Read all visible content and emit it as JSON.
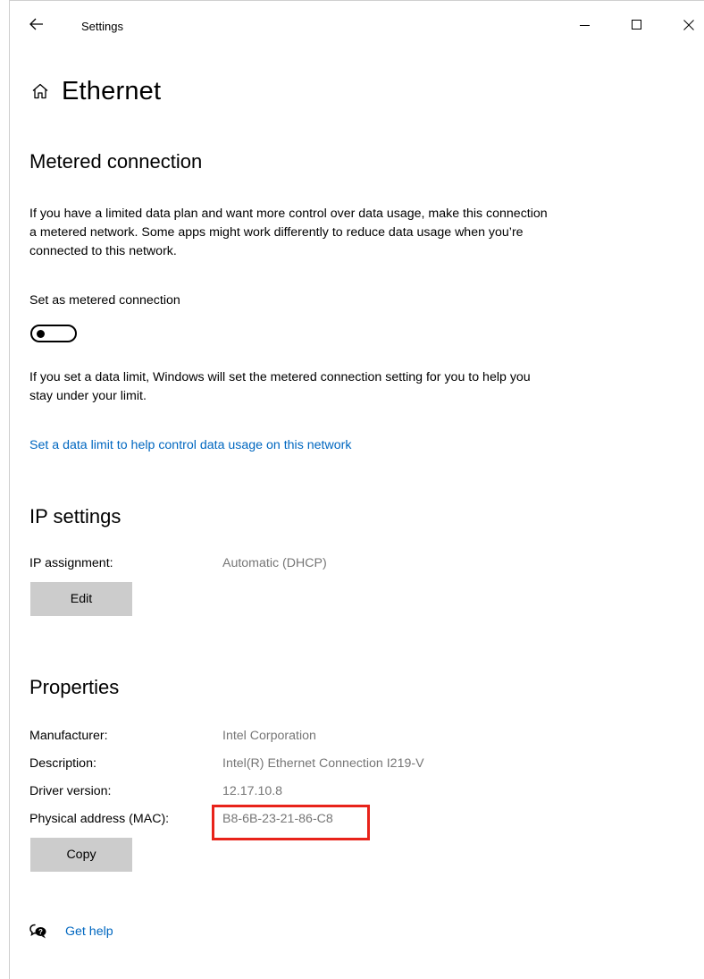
{
  "window": {
    "app_title": "Settings"
  },
  "header": {
    "title": "Ethernet",
    "home_icon": "home-icon"
  },
  "metered": {
    "section_title": "Metered connection",
    "description": "If you have a limited data plan and want more control over data usage, make this connection a metered network. Some apps might work differently to reduce data usage when you’re connected to this network.",
    "toggle_label": "Set as metered connection",
    "toggle_state": "Off",
    "limit_note": "If you set a data limit, Windows will set the metered connection setting for you to help you stay under your limit.",
    "limit_link": "Set a data limit to help control data usage on this network"
  },
  "ip_settings": {
    "section_title": "IP settings",
    "assignment_label": "IP assignment:",
    "assignment_value": "Automatic (DHCP)",
    "edit_button": "Edit"
  },
  "properties": {
    "section_title": "Properties",
    "rows": [
      {
        "key": "Manufacturer:",
        "value": "Intel Corporation"
      },
      {
        "key": "Description:",
        "value": "Intel(R) Ethernet Connection I219-V"
      },
      {
        "key": "Driver version:",
        "value": "12.17.10.8"
      },
      {
        "key": "Physical address (MAC):",
        "value": "B8-6B-23-21-86-C8"
      }
    ],
    "copy_button": "Copy"
  },
  "help": {
    "label": "Get help",
    "icon": "help-chat-icon"
  },
  "colors": {
    "link": "#0067c0",
    "value_text": "#767676",
    "button_bg": "#cccccc",
    "highlight": "#e8231a"
  }
}
